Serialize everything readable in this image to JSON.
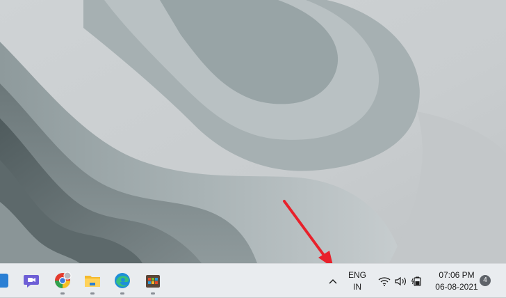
{
  "taskbar": {
    "apps": [
      {
        "name": "Chat",
        "icon": "chat-icon",
        "running": false
      },
      {
        "name": "Chrome",
        "icon": "chrome-icon",
        "running": true
      },
      {
        "name": "File Explorer",
        "icon": "folder-icon",
        "running": true
      },
      {
        "name": "Edge",
        "icon": "edge-icon",
        "running": true
      },
      {
        "name": "Store",
        "icon": "store-icon",
        "running": true
      }
    ],
    "tray": {
      "language_line1": "ENG",
      "language_line2": "IN",
      "time": "07:06 PM",
      "date": "06-08-2021",
      "notification_count": "4"
    }
  },
  "colors": {
    "annotation_arrow": "#e8212b",
    "taskbar_bg": "#e9ecef"
  }
}
